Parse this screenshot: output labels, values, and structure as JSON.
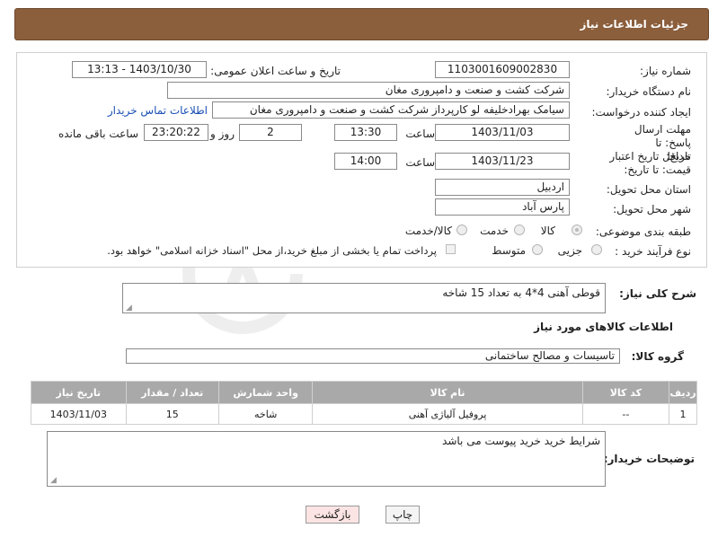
{
  "header": {
    "title": "جزئیات اطلاعات نیاز"
  },
  "form": {
    "need_number": {
      "label": "شماره نیاز:",
      "value": "1103001609002830"
    },
    "announce": {
      "label": "تاریخ و ساعت اعلان عمومی:",
      "value": "1403/10/30 - 13:13"
    },
    "buyer_org": {
      "label": "نام دستگاه خریدار:",
      "value": "شرکت کشت و صنعت و دامپروری مغان"
    },
    "creator": {
      "label": "ایجاد کننده درخواست:",
      "value": "سیامک بهرادخلیفه لو کارپرداز شرکت کشت و صنعت و دامپروری مغان",
      "contact_link": "اطلاعات تماس خریدار"
    },
    "reply_deadline": {
      "label": "مهلت ارسال پاسخ: تا تاریخ:",
      "date": "1403/11/03",
      "time_label": "ساعت",
      "time": "13:30",
      "days": "2",
      "days_label": "روز و",
      "remaining": "23:20:22",
      "remaining_label": "ساعت باقی مانده"
    },
    "price_validity": {
      "label": "حداقل تاریخ اعتبار قیمت: تا تاریخ:",
      "date": "1403/11/23",
      "time_label": "ساعت",
      "time": "14:00"
    },
    "province": {
      "label": "استان محل تحویل:",
      "value": "اردبیل"
    },
    "city": {
      "label": "شهر محل تحویل:",
      "value": "پارس آباد"
    },
    "category": {
      "label": "طبقه بندی موضوعی:",
      "options": [
        "کالا",
        "خدمت",
        "کالا/خدمت"
      ],
      "selected": "کالا"
    },
    "process": {
      "label": "نوع فرآیند خرید :",
      "options": [
        "جزیی",
        "متوسط"
      ],
      "note": "پرداخت تمام یا بخشی از مبلغ خرید،از محل \"اسناد خزانه اسلامی\" خواهد بود."
    }
  },
  "description": {
    "label": "شرح کلی نیاز:",
    "value": "قوطی آهنی 4*4 به تعداد 15 شاخه"
  },
  "goods_section": {
    "title": "اطلاعات کالاهای مورد نیاز"
  },
  "goods_group": {
    "label": "گروه کالا:",
    "value": "تاسیسات و مصالح ساختمانی"
  },
  "table": {
    "headers": [
      "ردیف",
      "کد کالا",
      "نام کالا",
      "واحد شمارش",
      "تعداد / مقدار",
      "تاریخ نیاز"
    ],
    "rows": [
      [
        "1",
        "--",
        "پروفیل آلیاژی آهنی",
        "شاخه",
        "15",
        "1403/11/03"
      ]
    ]
  },
  "buyer_notes": {
    "label": "توضیحات خریدار:",
    "value": "شرایط خرید خرید پیوست می باشد"
  },
  "buttons": {
    "print": "چاپ",
    "back": "بازگشت"
  },
  "watermark": {
    "text": "AriaTender.neT"
  },
  "colors": {
    "header_bg": "#8b5e3c",
    "table_header_bg": "#a9a9a9",
    "back_button_bg": "#fde4e4",
    "link": "#1a4fb5"
  }
}
